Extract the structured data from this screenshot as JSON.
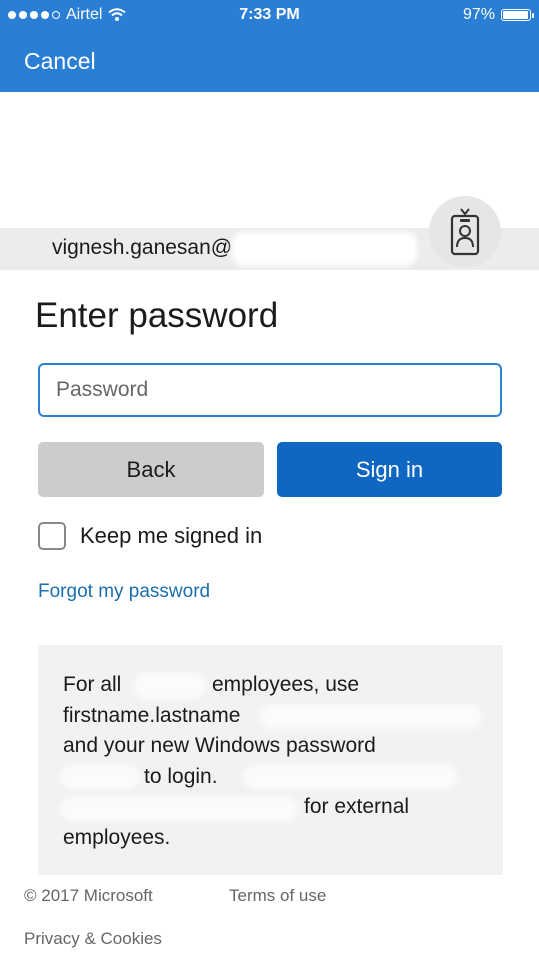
{
  "status_bar": {
    "carrier": "Airtel",
    "time": "7:33 PM",
    "battery": "97%"
  },
  "nav": {
    "cancel": "Cancel"
  },
  "account": {
    "email": "vignesh.ganesan@"
  },
  "heading": "Enter password",
  "password": {
    "placeholder": "Password",
    "value": ""
  },
  "buttons": {
    "back": "Back",
    "sign_in": "Sign in"
  },
  "keep_signed_in": {
    "label": "Keep me signed in",
    "checked": false
  },
  "forgot": "Forgot my password",
  "info": {
    "line1a": "For all",
    "line1b": "employees, use",
    "line2": "firstname.lastname",
    "line3": "and your new Windows password",
    "line4": "to login.",
    "line5": "for external",
    "line6": "employees."
  },
  "footer": {
    "copyright": "© 2017 Microsoft",
    "terms": "Terms of use",
    "privacy": "Privacy & Cookies"
  },
  "colors": {
    "header_blue": "#2a7fd4",
    "signin_blue": "#0f67c2",
    "link_blue": "#1b6fae"
  },
  "icons": [
    "wifi-icon",
    "battery-icon",
    "badge-icon"
  ]
}
